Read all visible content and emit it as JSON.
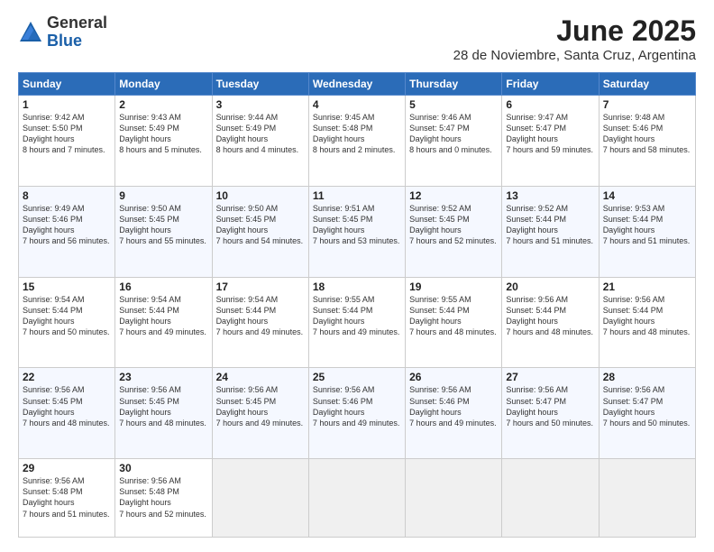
{
  "logo": {
    "general": "General",
    "blue": "Blue"
  },
  "title": "June 2025",
  "subtitle": "28 de Noviembre, Santa Cruz, Argentina",
  "days_header": [
    "Sunday",
    "Monday",
    "Tuesday",
    "Wednesday",
    "Thursday",
    "Friday",
    "Saturday"
  ],
  "weeks": [
    [
      {
        "day": "1",
        "sunrise": "9:42 AM",
        "sunset": "5:50 PM",
        "daylight": "8 hours and 7 minutes."
      },
      {
        "day": "2",
        "sunrise": "9:43 AM",
        "sunset": "5:49 PM",
        "daylight": "8 hours and 5 minutes."
      },
      {
        "day": "3",
        "sunrise": "9:44 AM",
        "sunset": "5:49 PM",
        "daylight": "8 hours and 4 minutes."
      },
      {
        "day": "4",
        "sunrise": "9:45 AM",
        "sunset": "5:48 PM",
        "daylight": "8 hours and 2 minutes."
      },
      {
        "day": "5",
        "sunrise": "9:46 AM",
        "sunset": "5:47 PM",
        "daylight": "8 hours and 0 minutes."
      },
      {
        "day": "6",
        "sunrise": "9:47 AM",
        "sunset": "5:47 PM",
        "daylight": "7 hours and 59 minutes."
      },
      {
        "day": "7",
        "sunrise": "9:48 AM",
        "sunset": "5:46 PM",
        "daylight": "7 hours and 58 minutes."
      }
    ],
    [
      {
        "day": "8",
        "sunrise": "9:49 AM",
        "sunset": "5:46 PM",
        "daylight": "7 hours and 56 minutes."
      },
      {
        "day": "9",
        "sunrise": "9:50 AM",
        "sunset": "5:45 PM",
        "daylight": "7 hours and 55 minutes."
      },
      {
        "day": "10",
        "sunrise": "9:50 AM",
        "sunset": "5:45 PM",
        "daylight": "7 hours and 54 minutes."
      },
      {
        "day": "11",
        "sunrise": "9:51 AM",
        "sunset": "5:45 PM",
        "daylight": "7 hours and 53 minutes."
      },
      {
        "day": "12",
        "sunrise": "9:52 AM",
        "sunset": "5:45 PM",
        "daylight": "7 hours and 52 minutes."
      },
      {
        "day": "13",
        "sunrise": "9:52 AM",
        "sunset": "5:44 PM",
        "daylight": "7 hours and 51 minutes."
      },
      {
        "day": "14",
        "sunrise": "9:53 AM",
        "sunset": "5:44 PM",
        "daylight": "7 hours and 51 minutes."
      }
    ],
    [
      {
        "day": "15",
        "sunrise": "9:54 AM",
        "sunset": "5:44 PM",
        "daylight": "7 hours and 50 minutes."
      },
      {
        "day": "16",
        "sunrise": "9:54 AM",
        "sunset": "5:44 PM",
        "daylight": "7 hours and 49 minutes."
      },
      {
        "day": "17",
        "sunrise": "9:54 AM",
        "sunset": "5:44 PM",
        "daylight": "7 hours and 49 minutes."
      },
      {
        "day": "18",
        "sunrise": "9:55 AM",
        "sunset": "5:44 PM",
        "daylight": "7 hours and 49 minutes."
      },
      {
        "day": "19",
        "sunrise": "9:55 AM",
        "sunset": "5:44 PM",
        "daylight": "7 hours and 48 minutes."
      },
      {
        "day": "20",
        "sunrise": "9:56 AM",
        "sunset": "5:44 PM",
        "daylight": "7 hours and 48 minutes."
      },
      {
        "day": "21",
        "sunrise": "9:56 AM",
        "sunset": "5:44 PM",
        "daylight": "7 hours and 48 minutes."
      }
    ],
    [
      {
        "day": "22",
        "sunrise": "9:56 AM",
        "sunset": "5:45 PM",
        "daylight": "7 hours and 48 minutes."
      },
      {
        "day": "23",
        "sunrise": "9:56 AM",
        "sunset": "5:45 PM",
        "daylight": "7 hours and 48 minutes."
      },
      {
        "day": "24",
        "sunrise": "9:56 AM",
        "sunset": "5:45 PM",
        "daylight": "7 hours and 49 minutes."
      },
      {
        "day": "25",
        "sunrise": "9:56 AM",
        "sunset": "5:46 PM",
        "daylight": "7 hours and 49 minutes."
      },
      {
        "day": "26",
        "sunrise": "9:56 AM",
        "sunset": "5:46 PM",
        "daylight": "7 hours and 49 minutes."
      },
      {
        "day": "27",
        "sunrise": "9:56 AM",
        "sunset": "5:47 PM",
        "daylight": "7 hours and 50 minutes."
      },
      {
        "day": "28",
        "sunrise": "9:56 AM",
        "sunset": "5:47 PM",
        "daylight": "7 hours and 50 minutes."
      }
    ],
    [
      {
        "day": "29",
        "sunrise": "9:56 AM",
        "sunset": "5:48 PM",
        "daylight": "7 hours and 51 minutes."
      },
      {
        "day": "30",
        "sunrise": "9:56 AM",
        "sunset": "5:48 PM",
        "daylight": "7 hours and 52 minutes."
      },
      null,
      null,
      null,
      null,
      null
    ]
  ]
}
